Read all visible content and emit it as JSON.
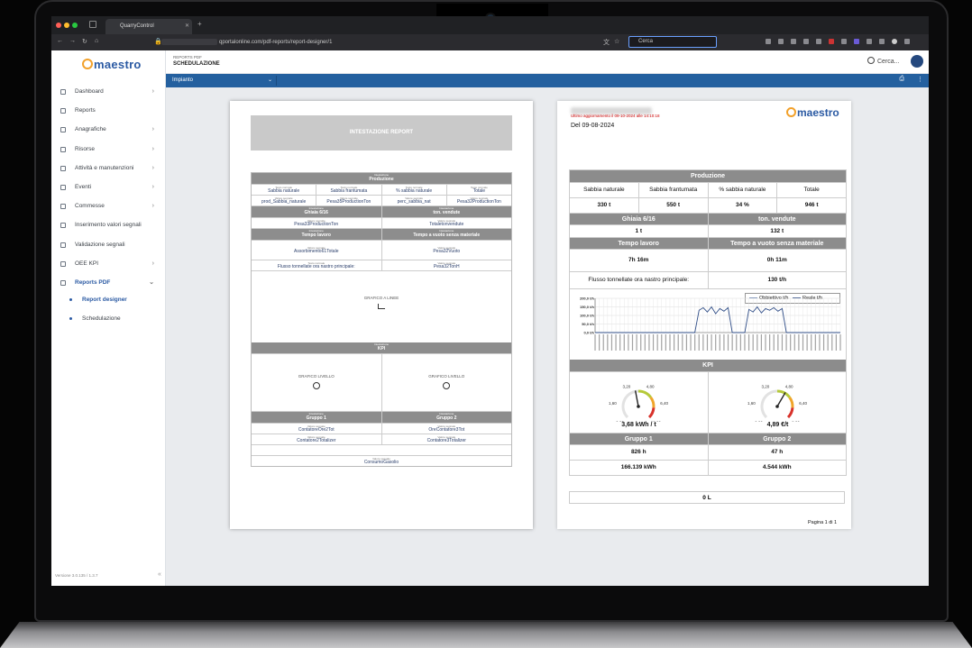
{
  "browser": {
    "tab_title": "QuarryControl",
    "url_visible": "qportalonline.com/pdf-reports/report-designer/1",
    "search_placeholder": "Cerca"
  },
  "app": {
    "logo_text": "maestro",
    "breadcrumb_top": "REPORTS PDF",
    "breadcrumb_title": "SCHEDULAZIONE",
    "search_label": "Cerca...",
    "version": "Versione 3.0.135 / 1.3.7",
    "plant_select": "Impianto"
  },
  "sidebar": {
    "items": [
      {
        "label": "Dashboard",
        "chevron": true
      },
      {
        "label": "Reports",
        "chevron": false
      },
      {
        "label": "Anagrafiche",
        "chevron": true
      },
      {
        "label": "Risorse",
        "chevron": true
      },
      {
        "label": "Attività e manutenzioni",
        "chevron": true
      },
      {
        "label": "Eventi",
        "chevron": true
      },
      {
        "label": "Commesse",
        "chevron": true
      },
      {
        "label": "Inserimento valori segnali",
        "chevron": false
      },
      {
        "label": "Validazione segnali",
        "chevron": false
      },
      {
        "label": "OEE KPI",
        "chevron": true
      },
      {
        "label": "Reports PDF",
        "chevron": true,
        "active": true
      }
    ],
    "subitems": [
      {
        "label": "Report designer",
        "active": true
      },
      {
        "label": "Schedulazione",
        "active": false
      }
    ]
  },
  "designer": {
    "header": "INTESTAZIONE REPORT",
    "sec_label": "Intestazione",
    "text_label": "Testo normale",
    "signal_label": "Valore segnale",
    "production": "Produzione",
    "prod_cols": [
      "Sabbia naturale",
      "Sabbia frantumata",
      "% sabbia naturale",
      "Totale"
    ],
    "prod_vals": [
      "prod_Sabbia_naturale",
      "Pesa35ProductionTon",
      "perc_sabbia_nat",
      "Pesa32ProductionTon"
    ],
    "ghiaia": "Ghiaia 6/16",
    "ton_vendute": "ton. vendute",
    "ghiaia_val": "Pesa33ProductionTon",
    "ton_val": "Totaletonvendute",
    "tempo_lavoro": "Tempo lavoro",
    "tempo_vuoto": "Tempo a vuoto senza materiale",
    "tempo_lavoro_val": "Assorbimento61Totale",
    "tempo_vuoto_val": "Pesa32Vuoto",
    "flusso_label": "Flusso tonnellate ora nastro principale:",
    "flusso_val": "Pesa32TonH",
    "graph_label": "GRAFICO A LINEE",
    "kpi": "KPI",
    "level_label": "GRAFICO LIVELLO",
    "gruppo1": "Gruppo 1",
    "gruppo2": "Gruppo 2",
    "g1_v1": "ContatoreOre2Tot",
    "g2_v1": "OreContatore3Tot",
    "g1_v2": "Contatore2Totalizer",
    "g2_v2": "Contatore3Totalizer",
    "footer_val": "ConsumoGasolio"
  },
  "preview": {
    "updated": "Ultimo aggiornamento il 09-10-2024 alle 14:10:18",
    "date": "Del 09-08-2024",
    "production": "Produzione",
    "prod_cols": [
      "Sabbia naturale",
      "Sabbia frantumata",
      "% sabbia naturale",
      "Totale"
    ],
    "prod_vals": [
      "330 t",
      "550 t",
      "34 %",
      "946 t"
    ],
    "ghiaia": "Ghiaia 6/16",
    "ton_vendute": "ton. vendute",
    "ghiaia_val": "1 t",
    "ton_val": "132 t",
    "tempo_lavoro": "Tempo lavoro",
    "tempo_vuoto": "Tempo a vuoto senza materiale",
    "tempo_lavoro_val": "7h 16m",
    "tempo_vuoto_val": "0h 11m",
    "flusso_label": "Flusso tonnellate ora nastro principale:",
    "flusso_val": "130 t/h",
    "legend_target": "Obbiettivo t/h",
    "legend_real": "Reale t/h",
    "kpi": "KPI",
    "gauge1_val": "3,68 kWh / t",
    "gauge2_val": "4,89 €/t",
    "gauge_ticks": [
      "0,00",
      "1,60",
      "3,20",
      "4,80",
      "6,40",
      "8,00"
    ],
    "gruppo1": "Gruppo 1",
    "gruppo2": "Gruppo 2",
    "g1_h": "826 h",
    "g2_h": "47 h",
    "g1_kwh": "166.139 kWh",
    "g2_kwh": "4.544 kWh",
    "footer_val": "0 L",
    "page": "Pagina 1 di 1",
    "gauge1": 3.68,
    "gauge2": 4.89,
    "gauge_max": 8
  },
  "chart_data": {
    "type": "line",
    "y_ticks": [
      "0,0 t/h",
      "50,0 t/h",
      "100,0 t/h",
      "150,0 t/h",
      "200,0 t/h"
    ],
    "ylim": [
      0,
      200
    ],
    "series": [
      {
        "name": "Obbiettivo t/h",
        "values": []
      },
      {
        "name": "Reale t/h",
        "values": [
          0,
          0,
          0,
          0,
          0,
          0,
          0,
          0,
          0,
          0,
          0,
          0,
          0,
          0,
          0,
          0,
          0,
          0,
          0,
          0,
          0,
          0,
          0,
          0,
          0,
          130,
          145,
          120,
          150,
          110,
          140,
          125,
          145,
          0,
          0,
          0,
          0,
          135,
          120,
          150,
          115,
          140,
          130,
          145,
          125,
          140,
          0,
          0,
          0,
          0,
          0,
          0,
          0,
          0,
          0,
          0,
          0,
          0,
          0,
          0
        ]
      }
    ]
  }
}
